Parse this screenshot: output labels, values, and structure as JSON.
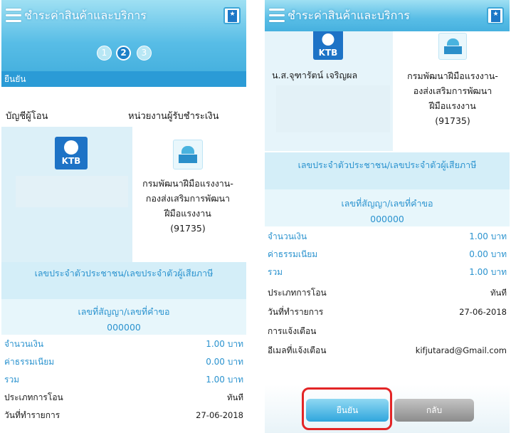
{
  "left_screen": {
    "header": {
      "title": "ชำระค่าสินค้าและบริการ",
      "menu_icon": "hamburger-icon",
      "bookmark_icon": "bookmark-star-icon",
      "bookmark_symbol": "★"
    },
    "steps": [
      {
        "label": "1",
        "active": false
      },
      {
        "label": "2",
        "active": true
      },
      {
        "label": "3",
        "active": false
      }
    ],
    "section_title": "ยืนยัน",
    "from_label": "บัญชีผู้โอน",
    "to_label": "หน่วยงานผู้รับชำระเงิน",
    "bank_logo_text": "KTB",
    "org_lines": [
      "กรมพัฒนาฝีมือแรงงาน-",
      "กองส่งเสริมการพัฒนา",
      "ฝีมือแรงงาน",
      "(91735)"
    ],
    "id_label": "เลขประจำตัวประชาชน/เลขประจำตัวผู้เสียภาษี",
    "contract_label": "เลขที่สัญญา/เลขที่คำขอ",
    "contract_value": "000000",
    "rows": [
      {
        "label": "จำนวนเงิน",
        "value": "1.00 บาท"
      },
      {
        "label": "ค่าธรรมเนียม",
        "value": "0.00 บาท"
      },
      {
        "label": "รวม",
        "value": "1.00 บาท"
      },
      {
        "label": "ประเภทการโอน",
        "value": "ทันที"
      },
      {
        "label": "วันที่ทำรายการ",
        "value": "27-06-2018"
      }
    ]
  },
  "right_screen": {
    "header": {
      "title": "ชำระค่าสินค้าและบริการ",
      "menu_icon": "hamburger-icon",
      "bookmark_icon": "bookmark-star-icon",
      "bookmark_symbol": "★"
    },
    "bank_logo_text": "KTB",
    "payer_name": "น.ส.จุฑารัตน์ เจริญผล",
    "org_lines": [
      "กรมพัฒนาฝีมือแรงงาน-",
      "องส่งเสริมการพัฒนา",
      "ฝีมือแรงงาน",
      "(91735)"
    ],
    "id_label": "เลขประจำตัวประชาชน/เลขประจำตัวผู้เสียภาษี",
    "contract_label": "เลขที่สัญญา/เลขที่คำขอ",
    "contract_value": "000000",
    "rows": [
      {
        "label": "จำนวนเงิน",
        "value": "1.00 บาท"
      },
      {
        "label": "ค่าธรรมเนียม",
        "value": "0.00 บาท"
      },
      {
        "label": "รวม",
        "value": "1.00 บาท"
      },
      {
        "label": "ประเภทการโอน",
        "value": "ทันที"
      },
      {
        "label": "วันที่ทำรายการ",
        "value": "27-06-2018"
      },
      {
        "label": "การแจ้งเตือน",
        "value": ""
      },
      {
        "label": "อีเมลที่แจ้งเตือน",
        "value": "kifjutarad@Gmail.com"
      }
    ],
    "confirm_label": "ยืนยัน",
    "back_label": "กลับ"
  },
  "colors": {
    "header_gradient": "#58bde6",
    "accent_blue": "#2b93cf",
    "panel_light": "#dcf0f8",
    "highlight_red": "#e32526"
  }
}
